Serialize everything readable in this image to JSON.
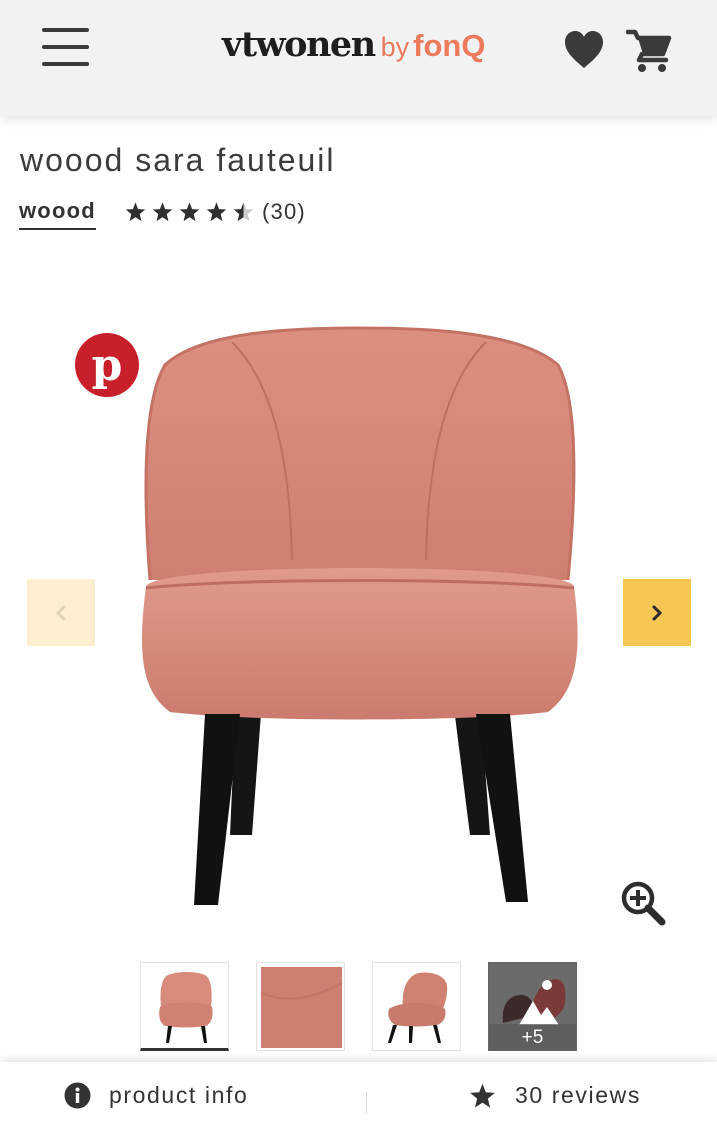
{
  "header": {
    "brand": "vtwonen",
    "by": "by",
    "partner": "fonQ",
    "icons": [
      "menu-icon",
      "heart-icon",
      "cart-icon"
    ]
  },
  "product": {
    "title": "woood sara fauteuil",
    "brand_link": "woood",
    "rating": 4.5,
    "rating_max": 5,
    "review_count_label": "(30)"
  },
  "gallery": {
    "pinterest_icon": "pinterest-icon",
    "prev_icon": "chevron-left-icon",
    "next_icon": "chevron-right-icon",
    "zoom_icon": "zoom-in-icon",
    "thumbnails": [
      {
        "name": "thumb-chair-front",
        "active": true
      },
      {
        "name": "thumb-fabric"
      },
      {
        "name": "thumb-chair-side"
      },
      {
        "name": "thumb-more",
        "more_label": "+5"
      }
    ]
  },
  "bottom_bar": {
    "info_label": "product info",
    "reviews_label": "30 reviews",
    "info_icon": "info-icon",
    "reviews_icon": "star-icon"
  },
  "colors": {
    "accent_yellow": "#f6c654",
    "accent_yellow_light": "#fcefd0",
    "brand_orange": "#ec7a5d",
    "pinterest_red": "#c8202b",
    "chair_pink": "#d98a7c",
    "header_bg": "#f2f2f2"
  }
}
